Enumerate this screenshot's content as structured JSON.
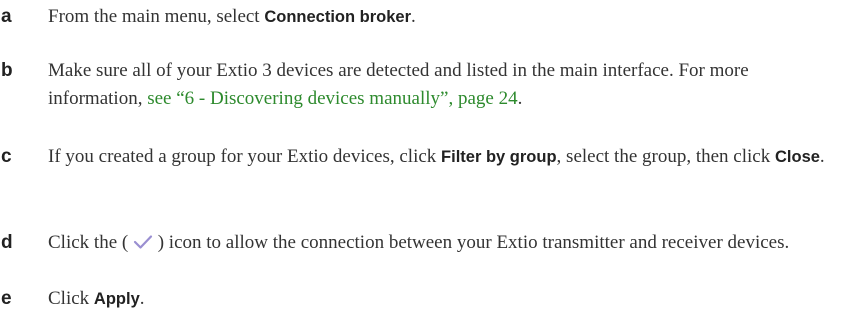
{
  "steps": [
    {
      "letter": "a",
      "pre": "From the main menu, select ",
      "ui": "Connection broker",
      "post": "."
    },
    {
      "letter": "b",
      "pre": "Make sure all of your Extio 3 devices are detected and listed in the main interface. For more information, ",
      "link": "see “6 - Discovering devices manually”, page 24",
      "post": "."
    },
    {
      "letter": "c",
      "pre": "If you created a group for your Extio devices, click ",
      "ui1": "Filter by group",
      "mid": ", select the group, then click ",
      "ui2": "Close",
      "post": "."
    },
    {
      "letter": "d",
      "pre": "Click the ",
      "icon_open": "(",
      "icon": "checkmark-icon",
      "icon_close": ")",
      "post": " icon to allow the connection between your Extio transmitter and receiver devices."
    },
    {
      "letter": "e",
      "pre": "Click ",
      "ui": "Apply",
      "post": "."
    }
  ],
  "colors": {
    "link": "#2d8a2d",
    "text": "#333333",
    "icon": "#9a8fd1"
  }
}
